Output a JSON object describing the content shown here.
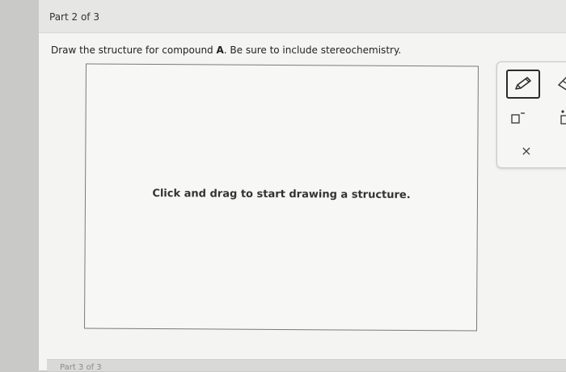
{
  "part_header": {
    "title": "Part 2 of 3"
  },
  "prompt": {
    "before": "Draw the structure for compound ",
    "bold": "A",
    "after": ". Be sure to include stereochemistry."
  },
  "canvas": {
    "hint": "Click and drag to start drawing a structure."
  },
  "toolbar": {
    "tools": [
      {
        "name": "pencil-icon"
      },
      {
        "name": "eraser-icon"
      },
      {
        "name": "square-charge-icon"
      },
      {
        "name": "template-icon"
      },
      {
        "name": "close-icon",
        "glyph": "×"
      }
    ]
  },
  "next_part": {
    "title": "Part 3 of 3"
  }
}
